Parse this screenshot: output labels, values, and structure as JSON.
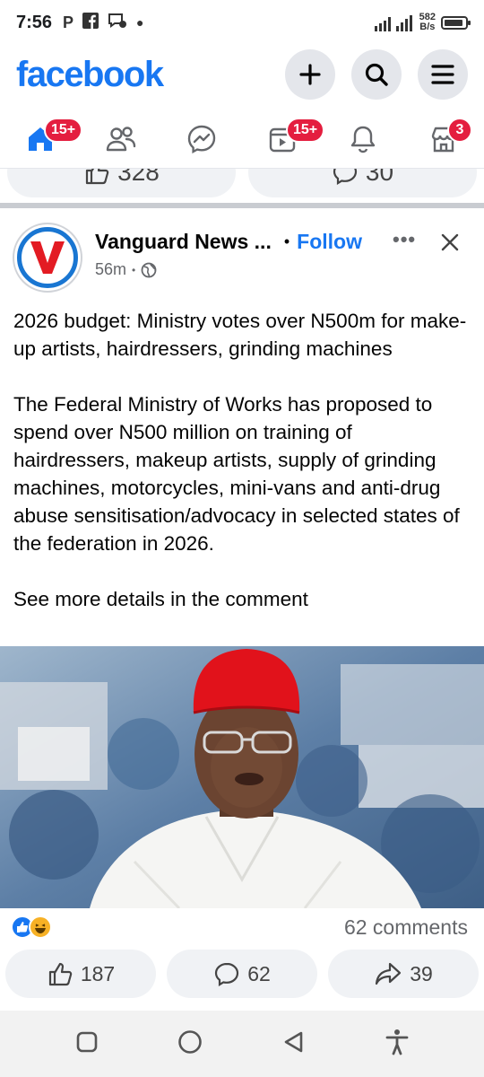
{
  "status_bar": {
    "time": "7:56",
    "carrier_letter": "P",
    "net_speed_value": "582",
    "net_speed_unit": "B/s",
    "battery_level": 0.9
  },
  "header": {
    "logo": "facebook",
    "actions": [
      "plus-icon",
      "search-icon",
      "menu-icon"
    ]
  },
  "tabs": [
    {
      "name": "home",
      "badge": "15+",
      "active": true
    },
    {
      "name": "friends",
      "badge": ""
    },
    {
      "name": "messenger",
      "badge": ""
    },
    {
      "name": "video",
      "badge": "15+"
    },
    {
      "name": "notifications",
      "badge": ""
    },
    {
      "name": "marketplace",
      "badge": "3"
    }
  ],
  "previous_post": {
    "like_count": "328",
    "comment_count": "30"
  },
  "post": {
    "page_name": "Vanguard News ...",
    "separator": "•",
    "follow_label": "Follow",
    "more_label": "•••",
    "time": "56m",
    "meta_dot": "•",
    "headline": "2026 budget: Ministry votes over N500m for make-up artists, hairdressers, grinding machines",
    "body": "The Federal Ministry of Works has proposed to spend over N500 million on training of hairdressers, makeup artists, supply of grinding machines, motorcycles, mini-vans and anti-drug abuse sensitisation/advocacy in selected states of the federation in 2026.",
    "footer": "See more details in the comment",
    "comments_count": "62 comments",
    "actions": {
      "likes": "187",
      "comments": "62",
      "shares": "39"
    }
  },
  "colors": {
    "brand": "#1877f2",
    "badge": "#e41e3f",
    "pill": "#f0f2f5"
  },
  "nav_bar": [
    "recent-apps-icon",
    "home-circle-icon",
    "back-triangle-icon",
    "accessibility-icon"
  ]
}
